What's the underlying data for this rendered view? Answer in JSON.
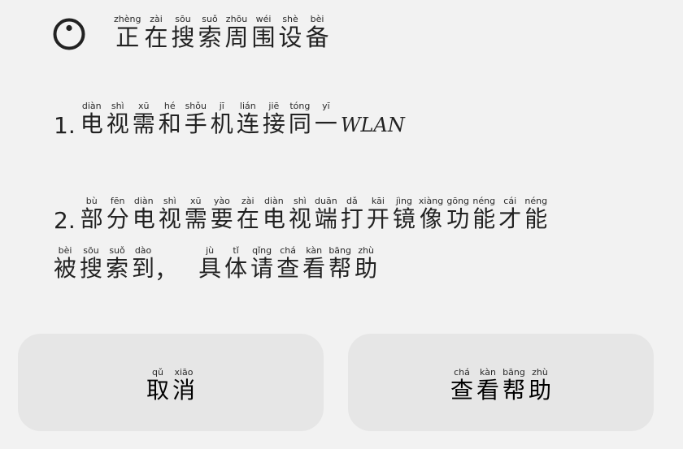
{
  "header": {
    "icon": "loading-spinner-icon",
    "title": [
      {
        "char": "正",
        "pinyin": "zhèng"
      },
      {
        "char": "在",
        "pinyin": "zài"
      },
      {
        "char": "搜",
        "pinyin": "sōu"
      },
      {
        "char": "索",
        "pinyin": "suǒ"
      },
      {
        "char": "周",
        "pinyin": "zhōu"
      },
      {
        "char": "围",
        "pinyin": "wéi"
      },
      {
        "char": "设",
        "pinyin": "shè"
      },
      {
        "char": "备",
        "pinyin": "bèi"
      }
    ]
  },
  "steps": {
    "step1": {
      "number": "1.",
      "chars": [
        {
          "char": "电",
          "pinyin": "diàn"
        },
        {
          "char": "视",
          "pinyin": "shì"
        },
        {
          "char": "需",
          "pinyin": "xū"
        },
        {
          "char": "和",
          "pinyin": "hé"
        },
        {
          "char": "手",
          "pinyin": "shǒu"
        },
        {
          "char": "机",
          "pinyin": "jī"
        },
        {
          "char": "连",
          "pinyin": "lián"
        },
        {
          "char": "接",
          "pinyin": "jiē"
        },
        {
          "char": "同",
          "pinyin": "tóng"
        },
        {
          "char": "一",
          "pinyin": "yī"
        }
      ],
      "suffix": "WLAN"
    },
    "step2": {
      "number": "2.",
      "line1": [
        {
          "char": "部",
          "pinyin": "bù"
        },
        {
          "char": "分",
          "pinyin": "fēn"
        },
        {
          "char": "电",
          "pinyin": "diàn"
        },
        {
          "char": "视",
          "pinyin": "shì"
        },
        {
          "char": "需",
          "pinyin": "xū"
        },
        {
          "char": "要",
          "pinyin": "yào"
        },
        {
          "char": "在",
          "pinyin": "zài"
        },
        {
          "char": "电",
          "pinyin": "diàn"
        },
        {
          "char": "视",
          "pinyin": "shì"
        },
        {
          "char": "端",
          "pinyin": "duān"
        },
        {
          "char": "打",
          "pinyin": "dǎ"
        },
        {
          "char": "开",
          "pinyin": "kāi"
        },
        {
          "char": "镜",
          "pinyin": "jìng"
        },
        {
          "char": "像",
          "pinyin": "xiàng"
        },
        {
          "char": "功",
          "pinyin": "gōng"
        },
        {
          "char": "能",
          "pinyin": "néng"
        },
        {
          "char": "才",
          "pinyin": "cái"
        },
        {
          "char": "能",
          "pinyin": "néng"
        }
      ],
      "line2a": [
        {
          "char": "被",
          "pinyin": "bèi"
        },
        {
          "char": "搜",
          "pinyin": "sōu"
        },
        {
          "char": "索",
          "pinyin": "suǒ"
        },
        {
          "char": "到",
          "pinyin": "dào"
        }
      ],
      "comma": "，",
      "line2b": [
        {
          "char": "具",
          "pinyin": "jù"
        },
        {
          "char": "体",
          "pinyin": "tǐ"
        },
        {
          "char": "请",
          "pinyin": "qǐng"
        },
        {
          "char": "查",
          "pinyin": "chá"
        },
        {
          "char": "看",
          "pinyin": "kàn"
        },
        {
          "char": "帮",
          "pinyin": "bāng"
        },
        {
          "char": "助",
          "pinyin": "zhù"
        }
      ]
    }
  },
  "buttons": {
    "cancel": [
      {
        "char": "取",
        "pinyin": "qǔ"
      },
      {
        "char": "消",
        "pinyin": "xiāo"
      }
    ],
    "help": [
      {
        "char": "查",
        "pinyin": "chá"
      },
      {
        "char": "看",
        "pinyin": "kàn"
      },
      {
        "char": "帮",
        "pinyin": "bāng"
      },
      {
        "char": "助",
        "pinyin": "zhù"
      }
    ]
  },
  "colors": {
    "background": "#f2f2f2",
    "button": "#e6e6e6",
    "text": "#222222"
  }
}
